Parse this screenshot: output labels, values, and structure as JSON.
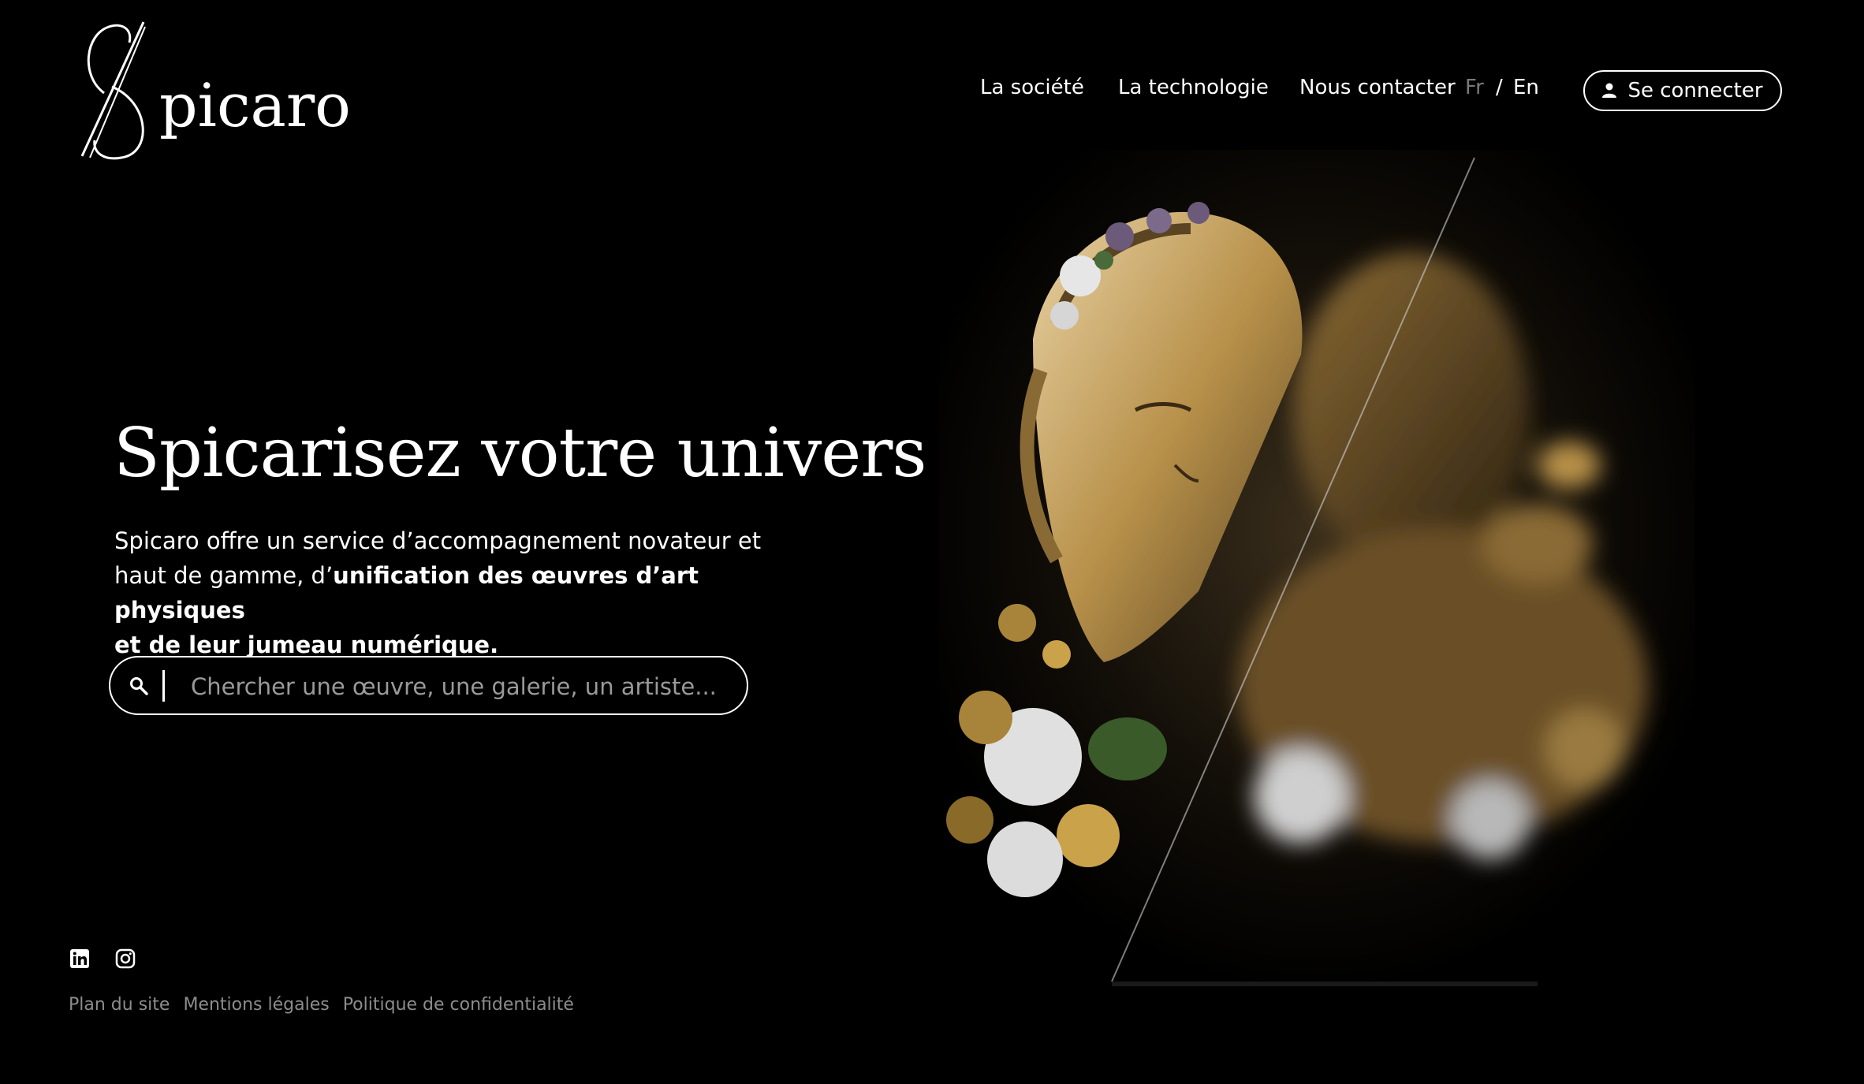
{
  "brand": {
    "name": "picaro"
  },
  "nav": {
    "items": [
      "La société",
      "La technologie",
      "Nous contacter"
    ],
    "lang_fr": "Fr",
    "lang_sep": "/",
    "lang_en": "En",
    "login_label": "Se connecter"
  },
  "hero": {
    "title": "Spicarisez votre univers",
    "text_line1": "Spicaro offre un service d’accompagnement novateur et",
    "text_line2_plain": "haut de gamme, d’",
    "text_line2_bold": "unification des œuvres d’art physiques",
    "text_line3_bold": "et de leur jumeau numérique."
  },
  "search": {
    "placeholder": "Chercher une œuvre, une galerie, un artiste..."
  },
  "footer": {
    "links": [
      "Plan du site",
      "Mentions légales",
      "Politique de confidentialité"
    ]
  },
  "icons": {
    "search": "search-icon",
    "user": "user-icon",
    "linkedin": "linkedin-icon",
    "instagram": "instagram-icon"
  },
  "colors": {
    "background": "#000000",
    "text": "#ffffff",
    "muted": "#8c8c8c",
    "gold": "#b8914a"
  }
}
